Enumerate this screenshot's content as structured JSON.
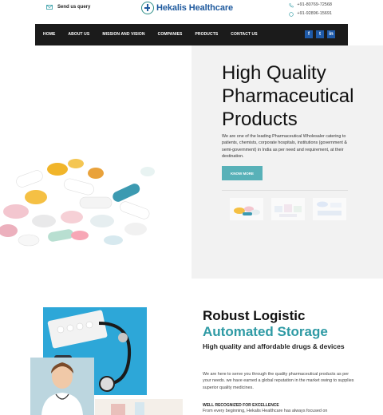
{
  "header": {
    "send_query": "Send us query",
    "brand": "Hekalis Healthcare",
    "phone_1": "+91-80769-72568",
    "phone_2": "+91-92896-15691"
  },
  "nav": {
    "items": [
      "HOME",
      "ABOUT US",
      "MISSION AND VISION",
      "COMPANIES",
      "PRODUCTS",
      "CONTACT US"
    ],
    "socials": [
      "f",
      "t",
      "in"
    ]
  },
  "hero": {
    "title_line1": "High Quality",
    "title_line2": "Pharmaceutical",
    "title_line3": "Products",
    "text": "We are one of the leading Pharmaceutical Wholesaler catering to patients, chemists, corporate hospitals, institutions (government & semi-government) in India as per need and requirement, at their destination.",
    "button": "KNOW MORE"
  },
  "section2": {
    "title": "Robust Logistic",
    "subtitle": "Automated Storage",
    "tagline": "High quality and affordable drugs & devices",
    "text": "We are here to serve you through the quality pharmaceutical products as per your needs. we have earned a global reputation in the market owing to supplies superior quality medicines.",
    "heading": "WELL RECOGNIZED FOR EXCELLENCE",
    "text2": "From every beginning, Hekalis Healthcare has always focused on"
  },
  "colors": {
    "accent": "#58b1b8",
    "brand_blue": "#1f5a9e",
    "nav_bg": "#1b1b1b",
    "teal_text": "#2e9aa4"
  }
}
